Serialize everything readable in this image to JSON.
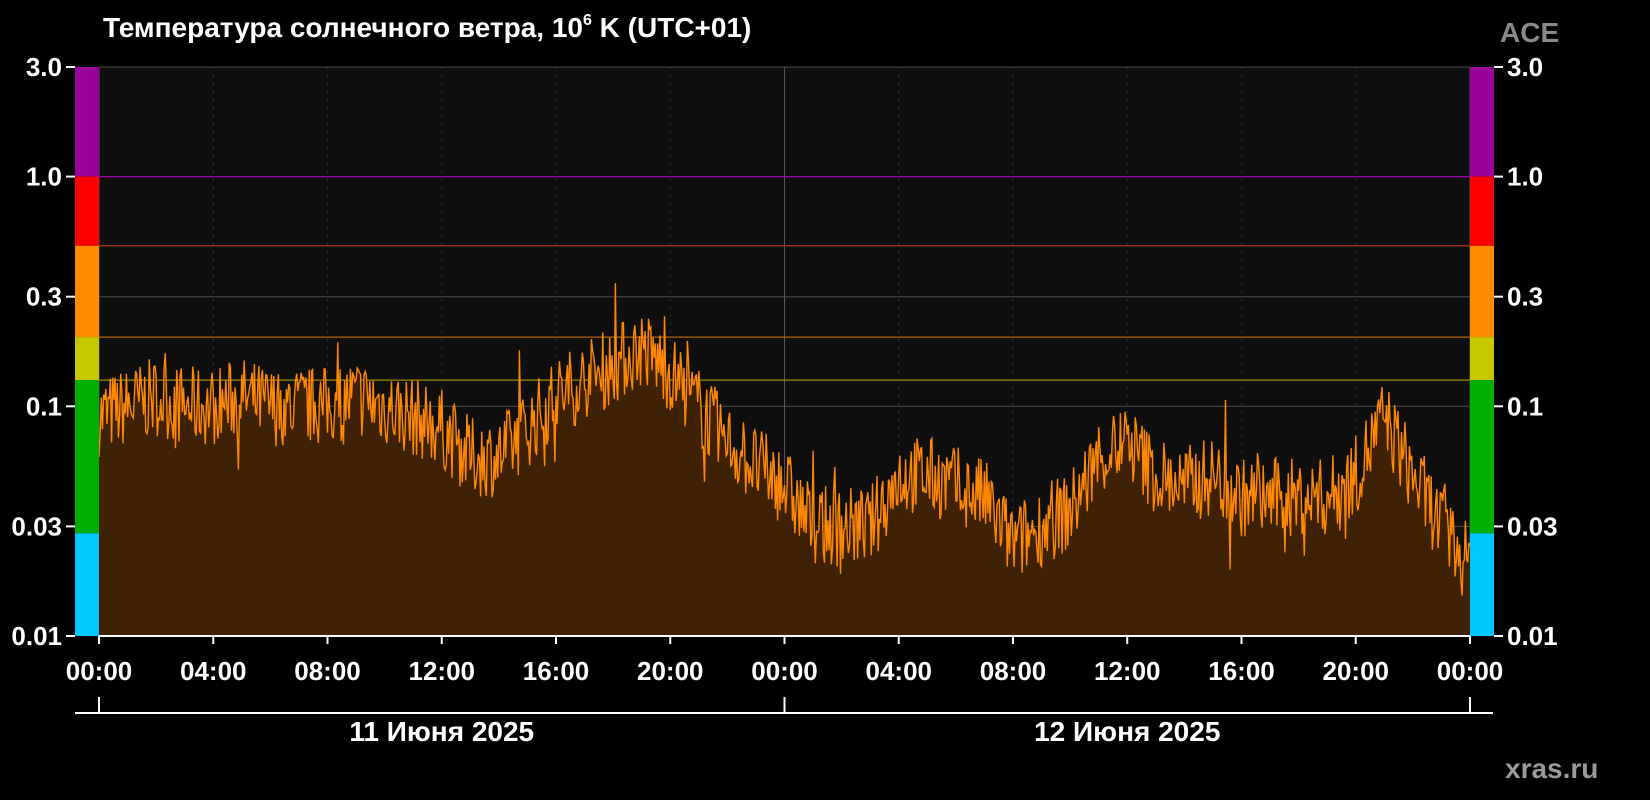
{
  "header": {
    "title_main": "Температура солнечного ветра, 10",
    "title_exp": "6",
    "title_rest": " K (UTC+01)",
    "source": "ACE"
  },
  "footer": {
    "site": "xras.ru"
  },
  "colors": {
    "background": "#000000",
    "plot_bg": "#0f0f0f",
    "line": "#ff8800",
    "fill": "#3f2105",
    "grid": "#4a4a4a",
    "threshold_violet": "#a000b0",
    "threshold_red": "#b0321a",
    "threshold_orange": "#b36200",
    "threshold_yellow": "#9a8a00"
  },
  "chart_data": {
    "type": "area",
    "title": "Температура солнечного ветра, 10^6 K (UTC+01)",
    "y_scale": "log",
    "ylim": [
      0.01,
      3.0
    ],
    "y_ticks": [
      "3.0",
      "1.0",
      "0.3",
      "0.1",
      "0.03",
      "0.01"
    ],
    "y_tick_values": [
      3.0,
      1.0,
      0.3,
      0.1,
      0.03,
      0.01
    ],
    "x_range": [
      "2025-06-11 00:00",
      "2025-06-13 00:00"
    ],
    "x_ticks": [
      "00:00",
      "04:00",
      "08:00",
      "12:00",
      "16:00",
      "20:00",
      "00:00",
      "04:00",
      "08:00",
      "12:00",
      "16:00",
      "20:00",
      "00:00"
    ],
    "x_tick_hours": [
      0,
      4,
      8,
      12,
      16,
      20,
      24,
      28,
      32,
      36,
      40,
      44,
      48
    ],
    "date_labels": [
      {
        "label": "11 Июня 2025",
        "start_hour": 0,
        "end_hour": 24
      },
      {
        "label": "12 Июня 2025",
        "start_hour": 24,
        "end_hour": 48
      }
    ],
    "thresholds": [
      {
        "value": 1.0,
        "color": "#a000b0"
      },
      {
        "value": 0.5,
        "color": "#b0321a"
      },
      {
        "value": 0.2,
        "color": "#b36200"
      },
      {
        "value": 0.13,
        "color": "#9a8a00"
      }
    ],
    "scale_bands": [
      {
        "from": 1.0,
        "to": 3.0,
        "color": "#9b009b"
      },
      {
        "from": 0.5,
        "to": 1.0,
        "color": "#ff0000"
      },
      {
        "from": 0.2,
        "to": 0.5,
        "color": "#ff8c00"
      },
      {
        "from": 0.13,
        "to": 0.2,
        "color": "#c8c800"
      },
      {
        "from": 0.028,
        "to": 0.13,
        "color": "#00b000"
      },
      {
        "from": 0.01,
        "to": 0.028,
        "color": "#00c8ff"
      }
    ],
    "grid": true,
    "series": [
      {
        "x_hours": [
          0,
          1,
          2,
          3,
          4,
          5,
          6,
          7,
          8,
          9,
          10,
          11,
          12,
          13,
          14,
          15,
          16,
          17,
          18,
          19,
          20,
          21,
          22,
          23,
          24,
          25,
          26,
          27,
          28,
          29,
          30,
          31,
          32,
          33,
          34,
          35,
          36,
          37,
          38,
          39,
          40,
          41,
          42,
          43,
          44,
          45,
          46,
          47,
          48
        ],
        "values": [
          0.09,
          0.1,
          0.11,
          0.1,
          0.1,
          0.11,
          0.1,
          0.1,
          0.1,
          0.11,
          0.1,
          0.09,
          0.08,
          0.06,
          0.06,
          0.08,
          0.11,
          0.13,
          0.15,
          0.18,
          0.14,
          0.1,
          0.07,
          0.055,
          0.045,
          0.03,
          0.03,
          0.03,
          0.05,
          0.05,
          0.045,
          0.04,
          0.025,
          0.03,
          0.035,
          0.06,
          0.07,
          0.05,
          0.045,
          0.05,
          0.04,
          0.04,
          0.04,
          0.04,
          0.05,
          0.09,
          0.05,
          0.03,
          0.02
        ]
      }
    ]
  }
}
